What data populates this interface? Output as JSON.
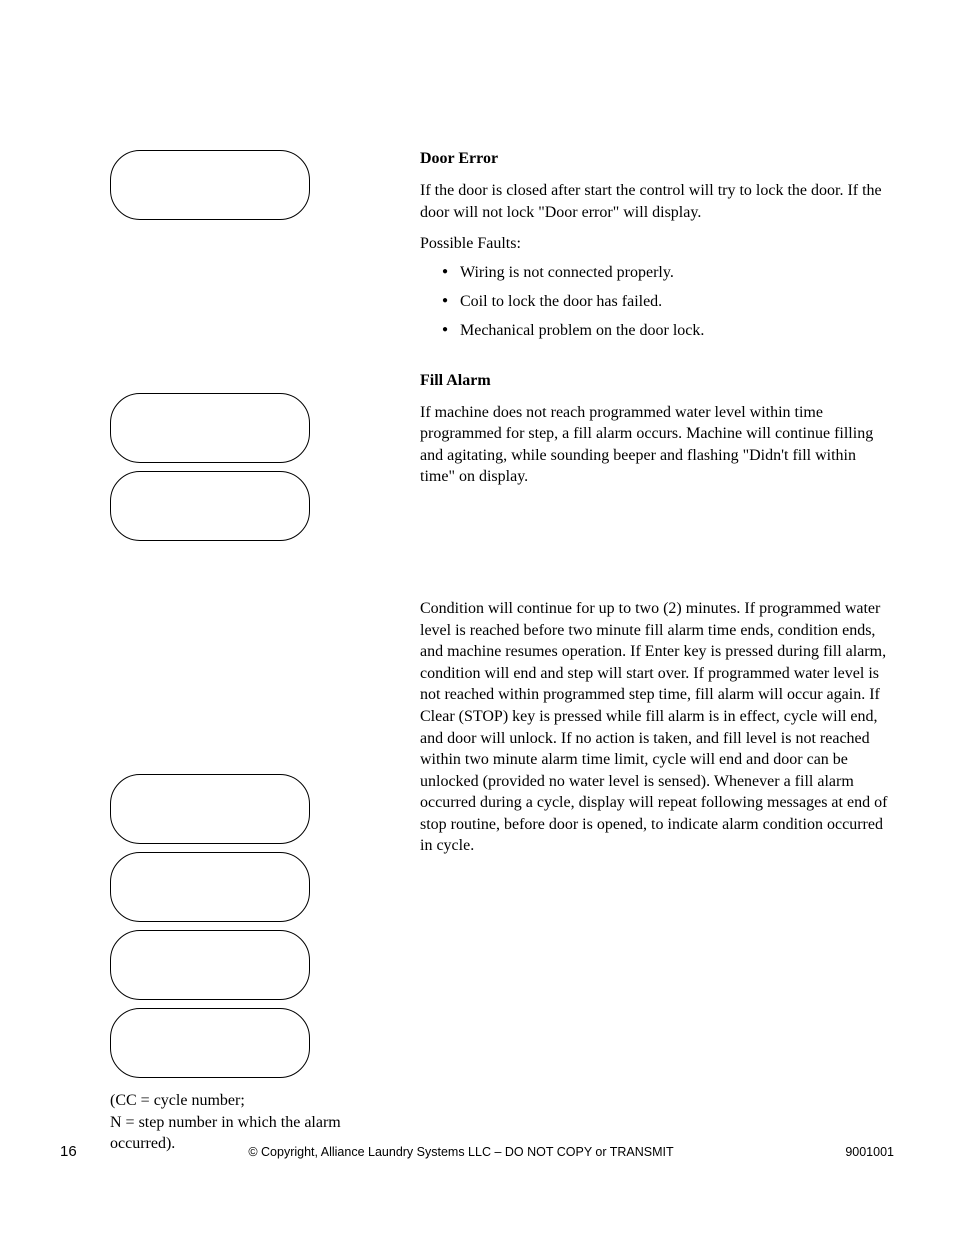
{
  "doorError": {
    "title": "Door Error",
    "body": "If the door is closed after start the control will try to lock the door. If the door will not lock \"Door error\" will display.",
    "faultsLabel": "Possible Faults:",
    "faults": [
      "Wiring is not connected properly.",
      "Coil to lock the door has failed.",
      "Mechanical problem on the door lock."
    ]
  },
  "fillAlarm": {
    "title": "Fill Alarm",
    "body1": "If machine does not reach programmed water level within time programmed for step, a fill alarm occurs. Machine will continue filling and agitating, while sounding beeper and flashing \"Didn't fill within time\" on display.",
    "body2": "Condition will continue for up to two (2) minutes. If programmed water level is reached before two minute fill alarm time ends, condition ends, and machine resumes operation. If Enter key is pressed during fill alarm, condition will end and step will start over. If programmed water level is not reached within programmed step time, fill alarm will occur again. If Clear (STOP) key is pressed while fill alarm is in effect, cycle will end, and door will unlock. If no action is taken, and fill level is not reached within two minute alarm time limit, cycle will end and door can be unlocked (provided no water level is sensed). Whenever a fill alarm occurred during a cycle, display will repeat following messages at end of stop routine, before door is opened, to indicate alarm condition occurred in cycle."
  },
  "caption": {
    "line1": "(CC = cycle number;",
    "line2": "N = step number in which the alarm occurred)."
  },
  "footer": {
    "pageNumber": "16",
    "copyright": "© Copyright, Alliance Laundry Systems LLC – DO NOT COPY or TRANSMIT",
    "docId": "9001001"
  }
}
